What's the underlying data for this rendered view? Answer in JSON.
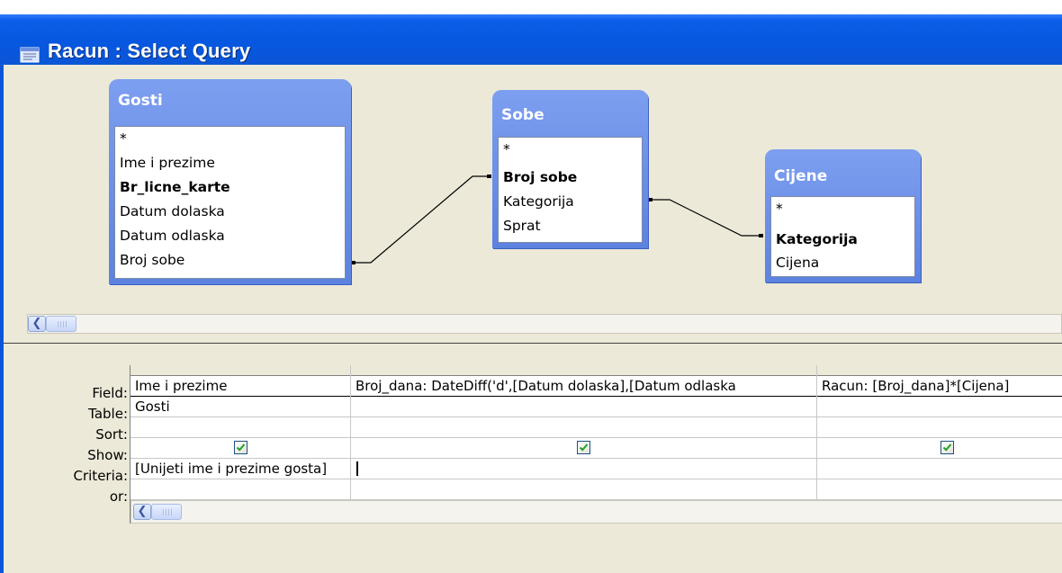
{
  "window": {
    "title": "Racun : Select Query"
  },
  "tables": [
    {
      "name": "Gosti",
      "fields": [
        {
          "label": "*",
          "key": false
        },
        {
          "label": "Ime i prezime",
          "key": false
        },
        {
          "label": "Br_licne_karte",
          "key": true
        },
        {
          "label": "Datum dolaska",
          "key": false
        },
        {
          "label": "Datum odlaska",
          "key": false
        },
        {
          "label": "Broj sobe",
          "key": false
        }
      ]
    },
    {
      "name": "Sobe",
      "fields": [
        {
          "label": "*",
          "key": false
        },
        {
          "label": "Broj sobe",
          "key": true
        },
        {
          "label": "Kategorija",
          "key": false
        },
        {
          "label": "Sprat",
          "key": false
        }
      ]
    },
    {
      "name": "Cijene",
      "fields": [
        {
          "label": "*",
          "key": false
        },
        {
          "label": "Kategorija",
          "key": true
        },
        {
          "label": "Cijena",
          "key": false
        }
      ]
    }
  ],
  "relationships": [
    {
      "from": "Gosti.Broj sobe",
      "to": "Sobe.Broj sobe"
    },
    {
      "from": "Sobe.Kategorija",
      "to": "Cijene.Kategorija"
    }
  ],
  "grid": {
    "row_labels": [
      "Field:",
      "Table:",
      "Sort:",
      "Show:",
      "Criteria:",
      "or:"
    ],
    "columns": [
      {
        "field": "Ime i prezime",
        "table": "Gosti",
        "sort": "",
        "show": true,
        "criteria": "[Unijeti ime i prezime gosta]",
        "or": ""
      },
      {
        "field": "Broj_dana: DateDiff('d',[Datum dolaska],[Datum odlaska",
        "table": "",
        "sort": "",
        "show": true,
        "criteria": "",
        "or": ""
      },
      {
        "field": "Racun: [Broj_dana]*[Cijena]",
        "table": "",
        "sort": "",
        "show": true,
        "criteria": "",
        "or": ""
      }
    ]
  },
  "icons": {
    "title": "query-window-icon",
    "scroll_left": "scroll-left-arrow-icon",
    "checkbox": "checkmark-icon"
  },
  "colors": {
    "titlebar": "#0a56d6",
    "table_header": "#6b8fe6",
    "panel_bg": "#ece9d8",
    "checkmark": "#21a121"
  }
}
